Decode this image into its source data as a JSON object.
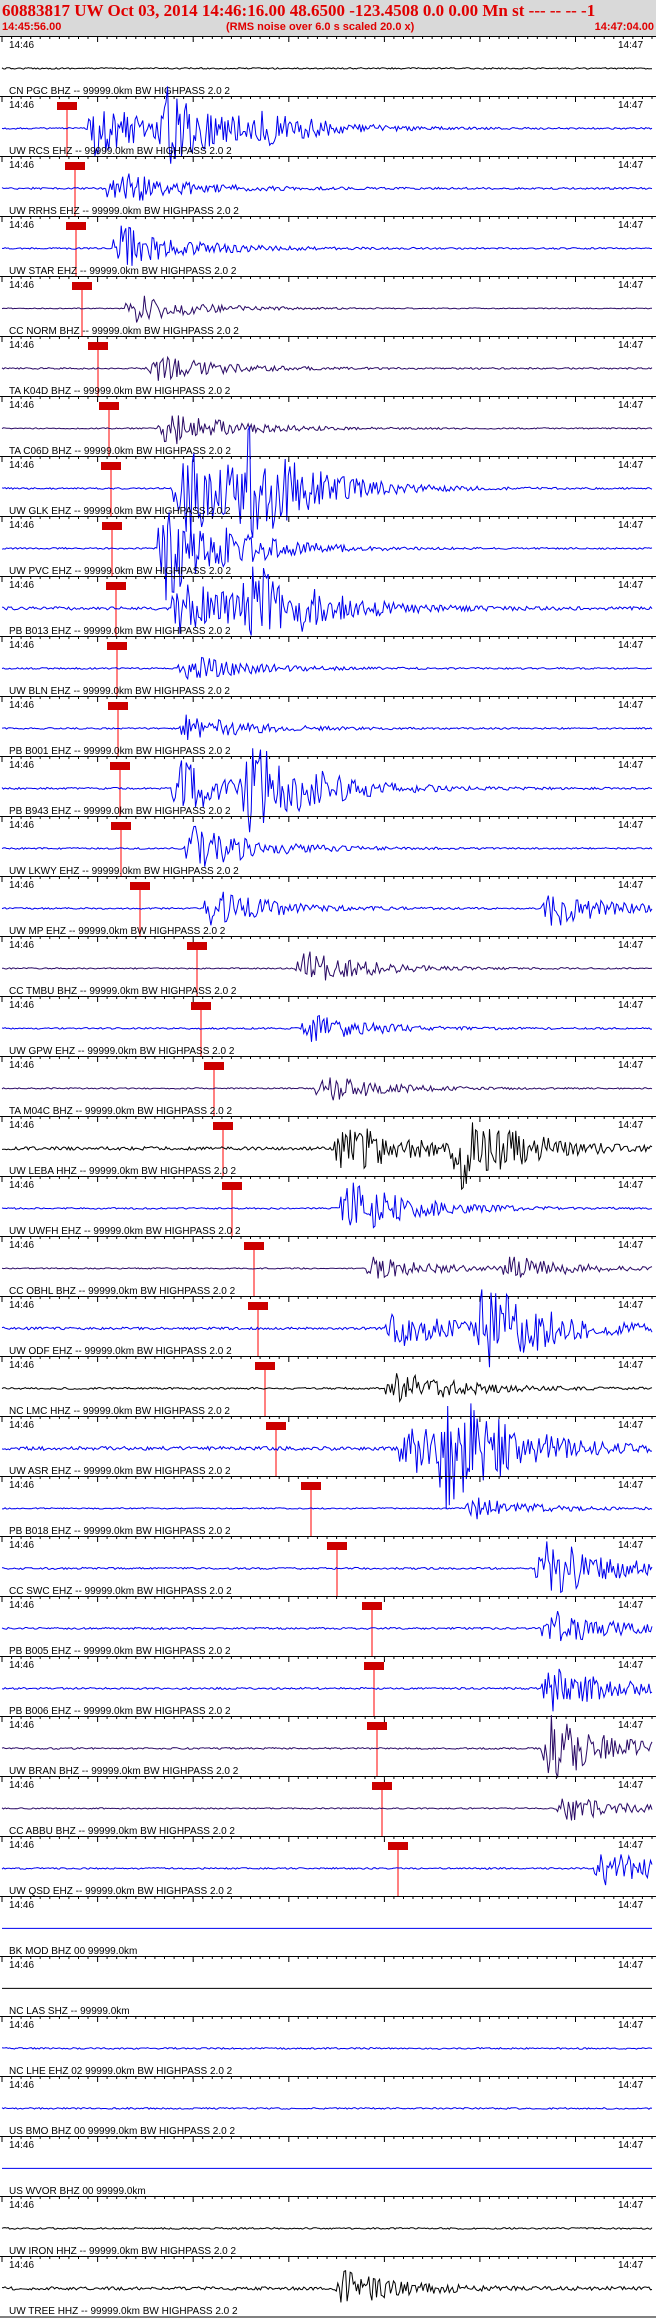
{
  "header": {
    "title": "60883817 UW Oct 03, 2014 14:46:16.00   48.6500 -123.4508  0.0 0.00 Mn st --- -- -- -1",
    "subtitle": "(RMS noise over 6.0 s scaled 20.0 x)",
    "start_time": "14:45:56.00",
    "end_time": "14:47:04.00"
  },
  "colors": {
    "header_bg": "#d9d9d9",
    "header_text": "#e00000",
    "blue": "#0000ee",
    "black": "#000000",
    "purple": "#2b0b66",
    "phase": "#ff0000",
    "phase_box": "#cc0000"
  },
  "chart_data": {
    "type": "line",
    "title": "60883817 UW Oct 03, 2014 14:46:16.00   48.6500 -123.4508  0.0 0.00 Mn st --- -- -- -1",
    "x_start": "14:45:56.00",
    "x_end": "14:47:04.00",
    "minute_labels": [
      "14:46",
      "14:47"
    ],
    "series": [
      {
        "name": "CN PGC BHZ -- 99999.0km BW  HIGHPASS  2.0  2",
        "color": "black",
        "pick": null,
        "p": 0.45,
        "e": null
      },
      {
        "name": "UW RCS EHZ -- 99999.0km BW  HIGHPASS  2.0  2",
        "color": "blue",
        "pick": "67",
        "p": 0.5,
        "e": [
          [
            0.14,
            3.0
          ],
          [
            0.25,
            3.5
          ],
          [
            0.4,
            1.2
          ]
        ]
      },
      {
        "name": "UW RRHS EHZ -- 99999.0km BW  HIGHPASS  2.0  2",
        "color": "blue",
        "pick": "75",
        "p": 0.6,
        "e": [
          [
            0.17,
            2.0
          ]
        ]
      },
      {
        "name": "UW STAR EHZ -- 99999.0km BW  HIGHPASS  2.0  2",
        "color": "blue",
        "pick": "76",
        "p": 0.5,
        "e": [
          [
            0.18,
            2.5
          ]
        ]
      },
      {
        "name": "CC NORM BHZ -- 99999.0km BW  HIGHPASS  2.0  2",
        "color": "purple",
        "pick": "82",
        "p": 0.3,
        "e": [
          [
            0.2,
            1.5
          ]
        ]
      },
      {
        "name": "TA K04D BHZ -- 99999.0km BW  HIGHPASS  2.0  2",
        "color": "purple",
        "pick": "98",
        "p": 0.5,
        "e": [
          [
            0.23,
            1.5
          ]
        ]
      },
      {
        "name": "TA C06D BHZ -- 99999.0km BW  HIGHPASS  2.0  2",
        "color": "purple",
        "pick": "109",
        "p": 0.4,
        "e": [
          [
            0.25,
            2.0
          ]
        ]
      },
      {
        "name": "UW GLK EHZ -- 99999.0km BW  HIGHPASS  2.0  2",
        "color": "blue",
        "pick": "111",
        "p": 0.5,
        "e": [
          [
            0.27,
            6.0
          ],
          [
            0.37,
            5.0
          ]
        ]
      },
      {
        "name": "UW PVC EHZ -- 99999.0km BW  HIGHPASS  2.0  2",
        "color": "blue",
        "pick": "112",
        "p": 0.5,
        "e": [
          [
            0.25,
            6.0
          ]
        ]
      },
      {
        "name": "PB B013 EHZ -- 99999.0km BW  HIGHPASS  2.0  2",
        "color": "blue",
        "pick": "116",
        "p": 1.0,
        "e": [
          [
            0.27,
            3.5
          ],
          [
            0.38,
            4.5
          ]
        ]
      },
      {
        "name": "UW BLN EHZ -- 99999.0km BW  HIGHPASS  2.0  2",
        "color": "blue",
        "pick": "117",
        "p": 0.5,
        "e": [
          [
            0.28,
            1.5
          ]
        ]
      },
      {
        "name": "PB B001 EHZ -- 99999.0km BW  HIGHPASS  2.0  2",
        "color": "blue",
        "pick": "118",
        "p": 0.5,
        "e": [
          [
            0.28,
            1.5
          ]
        ]
      },
      {
        "name": "PB B943 EHZ -- 99999.0km BW  HIGHPASS  2.0  2",
        "color": "blue",
        "pick": "120",
        "p": 0.6,
        "e": [
          [
            0.27,
            3.0
          ],
          [
            0.38,
            5.0
          ]
        ]
      },
      {
        "name": "UW LKWY EHZ -- 99999.0km BW  HIGHPASS  2.0  2",
        "color": "blue",
        "pick": "121",
        "p": 0.5,
        "e": [
          [
            0.29,
            2.5
          ]
        ]
      },
      {
        "name": "UW MP EHZ -- 99999.0km BW  HIGHPASS  2.0  2",
        "color": "blue",
        "pick": "140",
        "p": 0.5,
        "e": [
          [
            0.32,
            2.0
          ],
          [
            0.84,
            2.0
          ]
        ]
      },
      {
        "name": "CC TMBU BHZ -- 99999.0km BW  HIGHPASS  2.0  2",
        "color": "purple",
        "pick": "197",
        "p": 0.4,
        "e": [
          [
            0.46,
            2.0
          ]
        ]
      },
      {
        "name": "UW GPW EHZ -- 99999.0km BW  HIGHPASS  2.0  2",
        "color": "blue",
        "pick": "201",
        "p": 0.5,
        "e": [
          [
            0.47,
            1.5
          ]
        ]
      },
      {
        "name": "TA M04C BHZ -- 99999.0km BW  HIGHPASS  2.0  2",
        "color": "purple",
        "pick": "214",
        "p": 0.4,
        "e": [
          [
            0.49,
            1.5
          ]
        ]
      },
      {
        "name": "UW LEBA HHZ -- 99999.0km BW  HIGHPASS  2.0  2",
        "color": "black",
        "pick": "223",
        "p": 1.0,
        "e": [
          [
            0.52,
            3.0
          ],
          [
            0.7,
            4.0
          ]
        ]
      },
      {
        "name": "UW UWFH EHZ -- 99999.0km BW  HIGHPASS  2.0  2",
        "color": "blue",
        "pick": "232",
        "p": 0.5,
        "e": [
          [
            0.53,
            3.0
          ]
        ]
      },
      {
        "name": "CC OBHL BHZ -- 99999.0km BW  HIGHPASS  2.0  2",
        "color": "purple",
        "pick": "254",
        "p": 0.4,
        "e": [
          [
            0.57,
            1.2
          ],
          [
            0.78,
            1.2
          ]
        ]
      },
      {
        "name": "UW ODF EHZ -- 99999.0km BW  HIGHPASS  2.0  2",
        "color": "blue",
        "pick": "258",
        "p": 0.8,
        "e": [
          [
            0.6,
            2.0
          ],
          [
            0.73,
            5.5
          ]
        ]
      },
      {
        "name": "NC LMC HHZ -- 99999.0km BW  HIGHPASS  2.0  2",
        "color": "black",
        "pick": "265",
        "p": 0.6,
        "e": [
          [
            0.6,
            2.0
          ]
        ]
      },
      {
        "name": "UW ASR EHZ -- 99999.0km BW  HIGHPASS  2.0  2",
        "color": "blue",
        "pick": "276",
        "p": 1.2,
        "e": [
          [
            0.62,
            3.0
          ],
          [
            0.68,
            5.5
          ]
        ]
      },
      {
        "name": "PB B018 EHZ -- 99999.0km BW  HIGHPASS  2.0  2",
        "color": "blue",
        "pick": "311",
        "p": 0.4,
        "e": [
          [
            0.72,
            1.2
          ]
        ]
      },
      {
        "name": "CC SWC EHZ -- 99999.0km BW  HIGHPASS  2.0  2",
        "color": "blue",
        "pick": "337",
        "p": 0.6,
        "e": [
          [
            0.83,
            3.5
          ]
        ]
      },
      {
        "name": "PB B005 EHZ -- 99999.0km BW  HIGHPASS  2.0  2",
        "color": "blue",
        "pick": "372",
        "p": 0.6,
        "e": [
          [
            0.84,
            2.0
          ]
        ]
      },
      {
        "name": "PB B006 EHZ -- 99999.0km BW  HIGHPASS  2.0  2",
        "color": "blue",
        "pick": "374",
        "p": 0.6,
        "e": [
          [
            0.84,
            2.5
          ]
        ]
      },
      {
        "name": "UW BRAN BHZ -- 99999.0km BW  HIGHPASS  2.0  2",
        "color": "purple",
        "pick": "377",
        "p": 0.5,
        "e": [
          [
            0.84,
            3.5
          ]
        ]
      },
      {
        "name": "CC ABBU BHZ -- 99999.0km BW  HIGHPASS  2.0  2",
        "color": "purple",
        "pick": "382",
        "p": 0.4,
        "e": [
          [
            0.86,
            1.5
          ]
        ]
      },
      {
        "name": "UW QSD EHZ -- 99999.0km BW  HIGHPASS  2.0  2",
        "color": "blue",
        "pick": "398",
        "p": 0.5,
        "e": [
          [
            0.92,
            2.0
          ]
        ]
      },
      {
        "name": "BK MOD BHZ 00 99999.0km",
        "color": "blue",
        "pick": null,
        "p": 0,
        "e": null
      },
      {
        "name": "NC LAS SHZ -- 99999.0km",
        "color": "black",
        "pick": null,
        "p": 0,
        "e": null
      },
      {
        "name": "NC LHE EHZ 02 99999.0km BW  HIGHPASS  2.0  2",
        "color": "blue",
        "pick": null,
        "p": 0.5,
        "e": null
      },
      {
        "name": "US BMO BHZ 00 99999.0km BW  HIGHPASS  2.0  2",
        "color": "blue",
        "pick": null,
        "p": 0.5,
        "e": null
      },
      {
        "name": "US WVOR BHZ 00 99999.0km",
        "color": "blue",
        "pick": null,
        "p": 0,
        "e": null
      },
      {
        "name": "UW IRON HHZ -- 99999.0km BW  HIGHPASS  2.0  2",
        "color": "black",
        "pick": null,
        "p": 0.5,
        "e": null
      },
      {
        "name": "UW TREE HHZ -- 99999.0km BW  HIGHPASS  2.0  2",
        "color": "black",
        "pick": null,
        "p": 1.0,
        "e": [
          [
            0.52,
            1.8
          ]
        ]
      }
    ]
  }
}
